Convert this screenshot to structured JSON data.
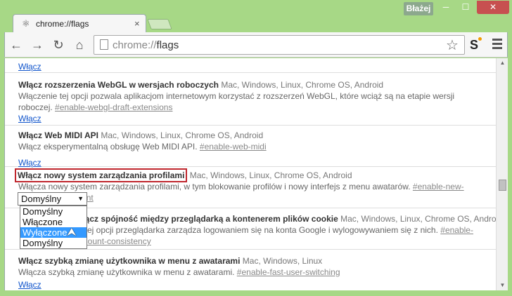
{
  "window": {
    "user": "Błażej",
    "minimize": "─",
    "maximize": "☐",
    "close": "✕"
  },
  "tab": {
    "title": "chrome://flags",
    "favicon": "⚛",
    "close": "×"
  },
  "toolbar": {
    "back": "←",
    "forward": "→",
    "reload": "↻",
    "home": "⌂",
    "url_scheme": "chrome://",
    "url_path": "flags",
    "star": "☆",
    "extension": "S"
  },
  "flags": [
    {
      "link": "Włącz"
    },
    {
      "title": "Włącz rozszerzenia WebGL w wersjach roboczych",
      "platforms": "Mac, Windows, Linux, Chrome OS, Android",
      "desc": "Włączenie tej opcji pozwala aplikacjom internetowym korzystać z rozszerzeń WebGL, które wciąż są na etapie wersji roboczej.",
      "id": "#enable-webgl-draft-extensions",
      "link": "Włącz"
    },
    {
      "title": "Włącz Web MIDI API",
      "platforms": "Mac, Windows, Linux, Chrome OS, Android",
      "desc": "Włącz eksperymentalną obsługę Web MIDI API.",
      "id": "#enable-web-midi",
      "link": "Włącz"
    },
    {
      "title": "Włącz nowy system zarządzania profilami",
      "platforms": "Mac, Windows, Linux, Chrome OS, Android",
      "desc": "Włącza nowy system zarządzania profilami, w tym blokowanie profilów i nowy interfejs z menu awatarów.",
      "id": "#enable-new-profile-management"
    },
    {
      "title": "Włącz spójność między przeglądarką a kontenerem plików cookie",
      "platforms": "Mac, Windows, Linux, Chrome OS, Android",
      "desc": "W tej opcji przeglądarka zarządza logowaniem się na konta Google i wylogowywaniem się z nich.",
      "id": "#enable-account-consistency"
    },
    {
      "title": "Włącz szybką zmianę użytkownika w menu z awatarami",
      "platforms": "Mac, Windows, Linux",
      "desc": "Włącza szybką zmianę użytkownika w menu z awatarami.",
      "id": "#enable-fast-user-switching",
      "link": "Włącz"
    }
  ],
  "select": {
    "value": "Domyślny",
    "options": [
      "Domyślny",
      "Włączone",
      "Wyłączone",
      "Domyślny"
    ],
    "highlighted_index": 2
  },
  "colors": {
    "frame": "#a7d886",
    "highlight_border": "#c0262d",
    "link": "#1155cc",
    "selected_option": "#3399ff"
  }
}
